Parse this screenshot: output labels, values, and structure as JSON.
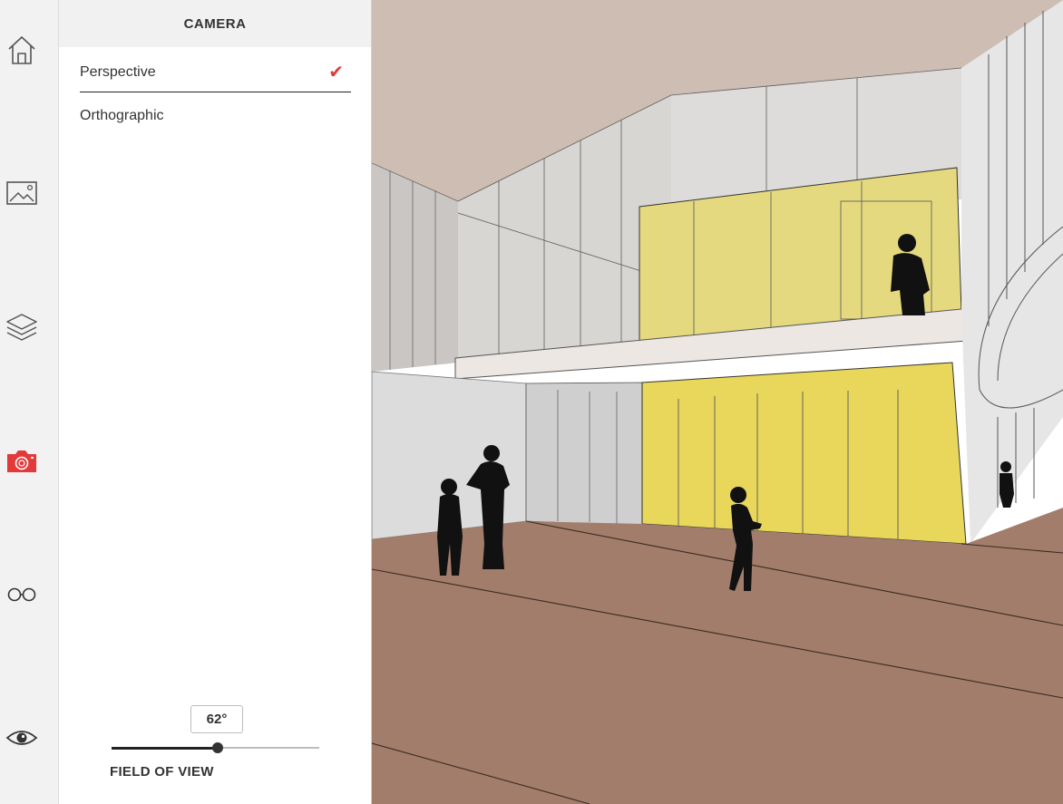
{
  "rail": {
    "items": [
      {
        "name": "home",
        "icon": "home-icon",
        "active": false
      },
      {
        "name": "scenes",
        "icon": "image-icon",
        "active": false
      },
      {
        "name": "layers",
        "icon": "layers-icon",
        "active": false
      },
      {
        "name": "camera",
        "icon": "camera-icon",
        "active": true
      },
      {
        "name": "view-mode",
        "icon": "glasses-icon",
        "active": false
      },
      {
        "name": "visibility",
        "icon": "eye-icon",
        "active": false
      }
    ]
  },
  "panel": {
    "title": "CAMERA",
    "options": [
      {
        "label": "Perspective",
        "selected": true
      },
      {
        "label": "Orthographic",
        "selected": false
      }
    ],
    "field_of_view": {
      "label": "FIELD OF VIEW",
      "value": "62°",
      "slider_fraction": 0.51
    }
  },
  "colors": {
    "accent": "#e23a3a",
    "wall_yellow": "#e8d75a",
    "floor": "#a27d6b",
    "ceiling": "#cdbdb3"
  }
}
